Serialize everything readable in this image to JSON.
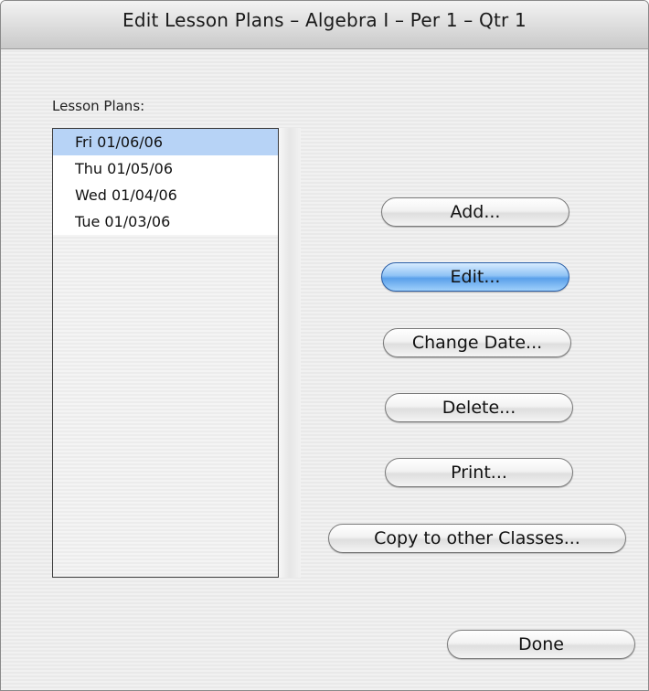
{
  "window": {
    "title": "Edit Lesson Plans – Algebra I – Per 1 – Qtr 1"
  },
  "lesson_plans": {
    "label": "Lesson Plans:",
    "items": [
      {
        "label": "Fri 01/06/06",
        "selected": true
      },
      {
        "label": "Thu 01/05/06",
        "selected": false
      },
      {
        "label": "Wed 01/04/06",
        "selected": false
      },
      {
        "label": "Tue 01/03/06",
        "selected": false
      }
    ]
  },
  "buttons": {
    "add": "Add...",
    "edit": "Edit...",
    "change_date": "Change Date...",
    "delete": "Delete...",
    "print": "Print...",
    "copy": "Copy to other Classes...",
    "done": "Done"
  },
  "colors": {
    "selection": "#b7d3f6",
    "default_button": "#5aa0ea"
  }
}
